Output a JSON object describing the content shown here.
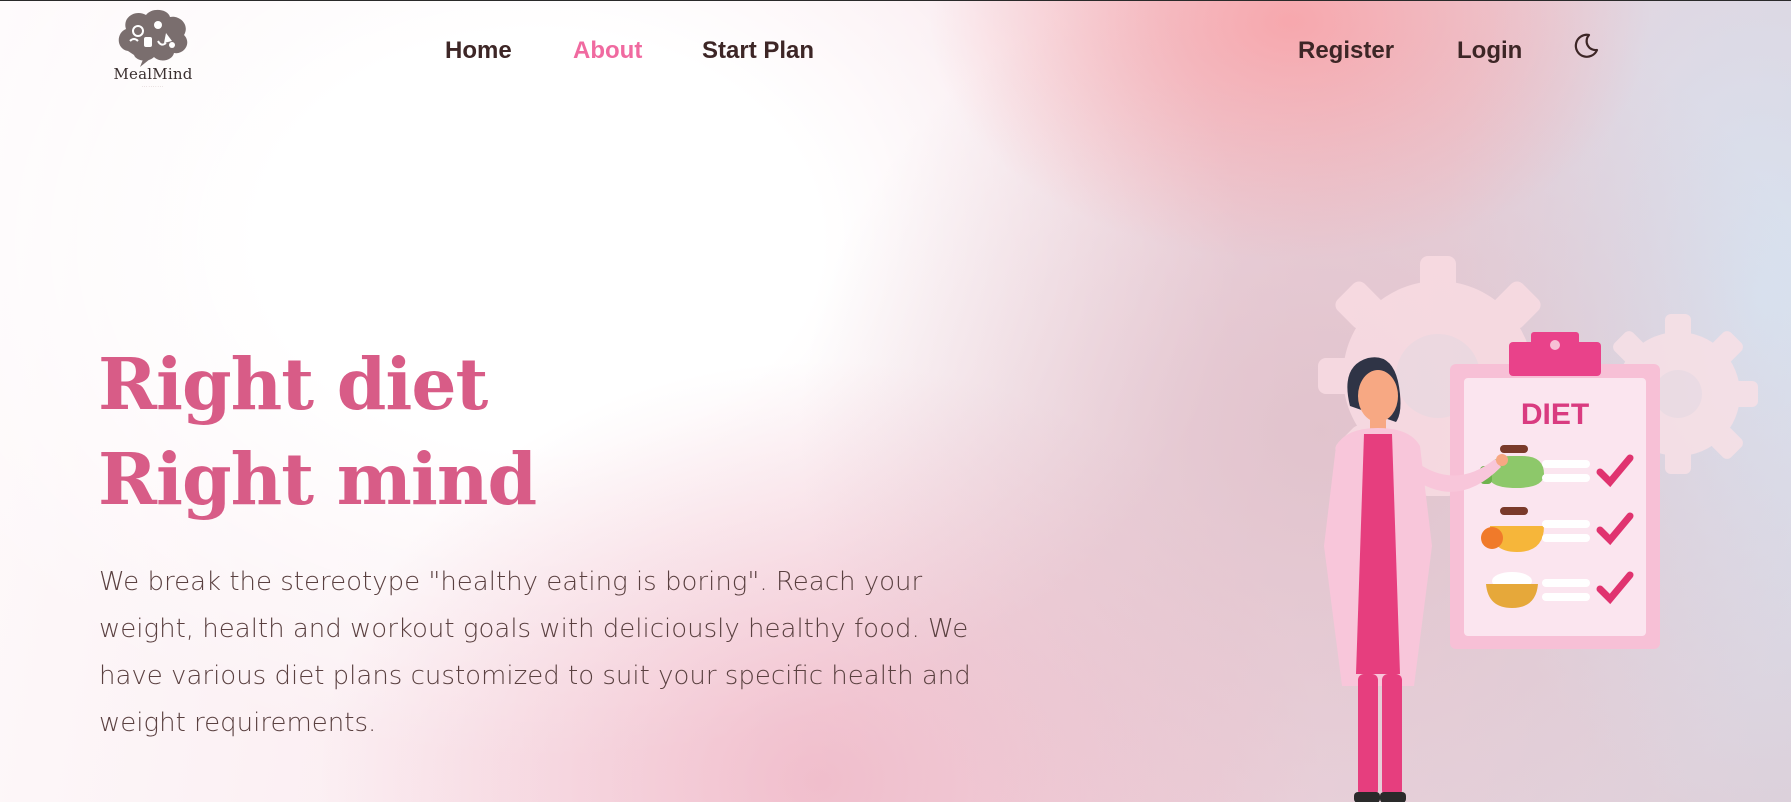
{
  "brand": {
    "name": "MealMind"
  },
  "nav": {
    "links": [
      {
        "label": "Home",
        "active": false
      },
      {
        "label": "About",
        "active": true
      },
      {
        "label": "Start Plan",
        "active": false
      }
    ],
    "register_label": "Register",
    "login_label": "Login",
    "theme_icon": "moon-icon"
  },
  "hero": {
    "title_line1": "Right diet",
    "title_line2": "Right mind",
    "description": "We break the stereotype \"healthy eating is boring\". Reach your weight, health and workout goals with deliciously healthy food. We have various diet plans customized to suit your specific health and weight requirements."
  },
  "illustration": {
    "clipboard_label": "DIET"
  },
  "colors": {
    "accent": "#f06aa0",
    "title": "#d85c87",
    "nav_text": "#3d2626",
    "body_text": "#5a4040"
  }
}
